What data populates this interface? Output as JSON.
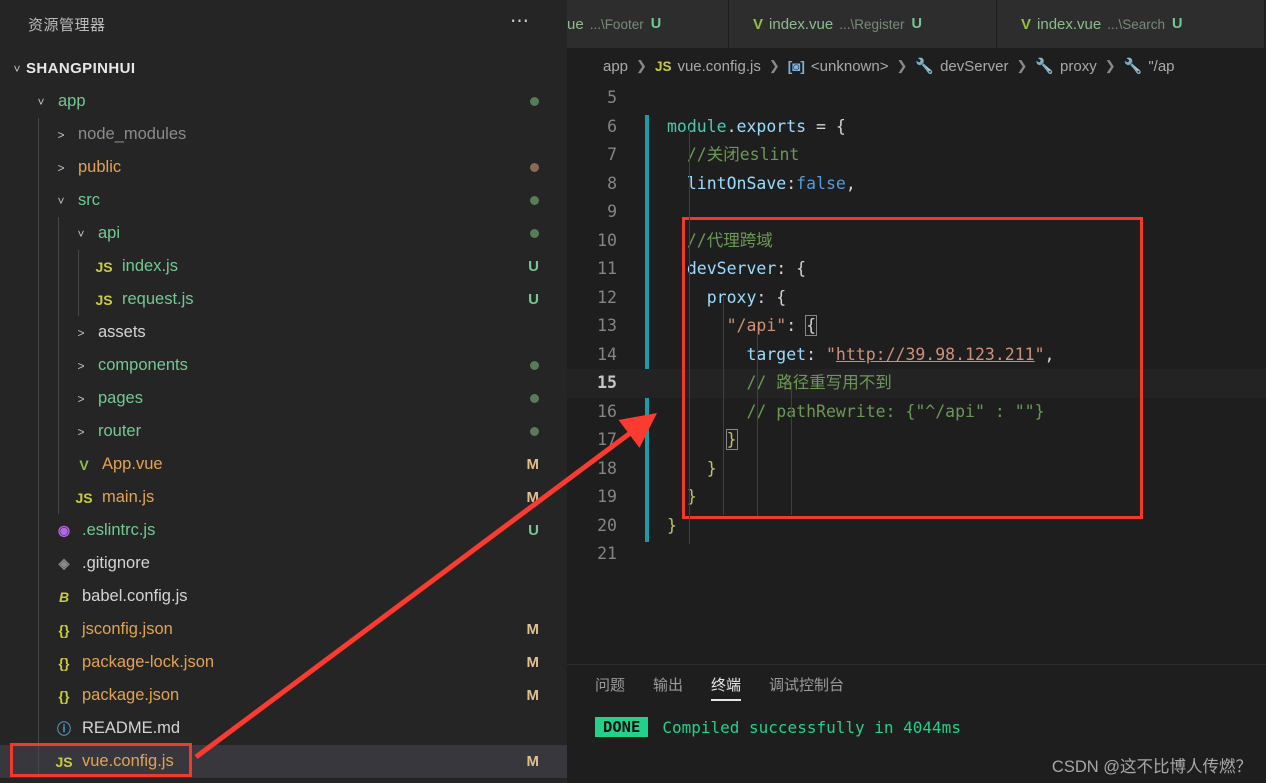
{
  "sidebar": {
    "title": "资源管理器",
    "actions_icon": "more-actions-icon",
    "root": "SHANGPINHUI",
    "items": [
      {
        "label": "app",
        "type": "folder",
        "expanded": true,
        "depth": 1,
        "icon": "chevron-down-icon",
        "color": "c-folder-green",
        "badge": "",
        "dot": "dot-green"
      },
      {
        "label": "node_modules",
        "type": "folder",
        "expanded": false,
        "depth": 2,
        "icon": "chevron-right-icon",
        "color": "c-folder-gray",
        "badge": "",
        "dot": ""
      },
      {
        "label": "public",
        "type": "folder",
        "expanded": false,
        "depth": 2,
        "icon": "chevron-right-icon",
        "color": "c-folder-orange",
        "badge": "",
        "dot": "dot-brown"
      },
      {
        "label": "src",
        "type": "folder",
        "expanded": true,
        "depth": 2,
        "icon": "chevron-down-icon",
        "color": "c-folder-green",
        "badge": "",
        "dot": "dot-green"
      },
      {
        "label": "api",
        "type": "folder",
        "expanded": true,
        "depth": 3,
        "icon": "chevron-down-icon",
        "color": "c-folder-green",
        "badge": "",
        "dot": "dot-green"
      },
      {
        "label": "index.js",
        "type": "file",
        "depth": 4,
        "fileicon": "js-icon",
        "iconclass": "ic-js",
        "icontext": "JS",
        "color": "c-file-green",
        "badge": "U",
        "badgeclass": "badge-U"
      },
      {
        "label": "request.js",
        "type": "file",
        "depth": 4,
        "fileicon": "js-icon",
        "iconclass": "ic-js",
        "icontext": "JS",
        "color": "c-file-green",
        "badge": "U",
        "badgeclass": "badge-U"
      },
      {
        "label": "assets",
        "type": "folder",
        "expanded": false,
        "depth": 3,
        "icon": "chevron-right-icon",
        "color": "c-file-dimwhite",
        "badge": "",
        "dot": ""
      },
      {
        "label": "components",
        "type": "folder",
        "expanded": false,
        "depth": 3,
        "icon": "chevron-right-icon",
        "color": "c-folder-green",
        "badge": "",
        "dot": "dot-green"
      },
      {
        "label": "pages",
        "type": "folder",
        "expanded": false,
        "depth": 3,
        "icon": "chevron-right-icon",
        "color": "c-folder-green",
        "badge": "",
        "dot": "dot-green"
      },
      {
        "label": "router",
        "type": "folder",
        "expanded": false,
        "depth": 3,
        "icon": "chevron-right-icon",
        "color": "c-folder-green",
        "badge": "",
        "dot": "dot-green"
      },
      {
        "label": "App.vue",
        "type": "file",
        "depth": 3,
        "fileicon": "vue-icon",
        "iconclass": "ic-vue",
        "icontext": "V",
        "color": "c-file-orange",
        "badge": "M",
        "badgeclass": "badge-M"
      },
      {
        "label": "main.js",
        "type": "file",
        "depth": 3,
        "fileicon": "js-icon",
        "iconclass": "ic-js",
        "icontext": "JS",
        "color": "c-file-orange",
        "badge": "M",
        "badgeclass": "badge-M"
      },
      {
        "label": ".eslintrc.js",
        "type": "file",
        "depth": 2,
        "fileicon": "eslint-icon",
        "iconclass": "ic-eslint",
        "icontext": "◉",
        "color": "c-file-green",
        "badge": "U",
        "badgeclass": "badge-U"
      },
      {
        "label": ".gitignore",
        "type": "file",
        "depth": 2,
        "fileicon": "git-icon",
        "iconclass": "ic-git",
        "icontext": "◈",
        "color": "c-file-dimwhite",
        "badge": "",
        "badgeclass": ""
      },
      {
        "label": "babel.config.js",
        "type": "file",
        "depth": 2,
        "fileicon": "babel-icon",
        "iconclass": "ic-babel",
        "icontext": "B",
        "color": "c-file-dimwhite",
        "badge": "",
        "badgeclass": ""
      },
      {
        "label": "jsconfig.json",
        "type": "file",
        "depth": 2,
        "fileicon": "json-icon",
        "iconclass": "ic-json",
        "icontext": "{}",
        "color": "c-file-orange",
        "badge": "M",
        "badgeclass": "badge-M"
      },
      {
        "label": "package-lock.json",
        "type": "file",
        "depth": 2,
        "fileicon": "json-icon",
        "iconclass": "ic-json",
        "icontext": "{}",
        "color": "c-file-orange",
        "badge": "M",
        "badgeclass": "badge-M"
      },
      {
        "label": "package.json",
        "type": "file",
        "depth": 2,
        "fileicon": "json-icon",
        "iconclass": "ic-json",
        "icontext": "{}",
        "color": "c-file-orange",
        "badge": "M",
        "badgeclass": "badge-M"
      },
      {
        "label": "README.md",
        "type": "file",
        "depth": 2,
        "fileicon": "markdown-icon",
        "iconclass": "ic-md",
        "icontext": "ⓘ",
        "color": "c-file-dimwhite",
        "badge": "",
        "badgeclass": ""
      },
      {
        "label": "vue.config.js",
        "type": "file",
        "depth": 2,
        "fileicon": "js-icon",
        "iconclass": "ic-js",
        "icontext": "JS",
        "color": "c-file-orange",
        "badge": "M",
        "badgeclass": "badge-M",
        "selected": true,
        "highlighted": true
      }
    ]
  },
  "tabs": [
    {
      "name": "ue",
      "desc": "...\\Footer",
      "badge": "U",
      "icon": "vue-icon",
      "clipped": true,
      "active": false
    },
    {
      "name": "index.vue",
      "desc": "...\\Register",
      "badge": "U",
      "icon": "vue-icon",
      "clipped": false,
      "active": false
    },
    {
      "name": "index.vue",
      "desc": "...\\Search",
      "badge": "U",
      "icon": "vue-icon",
      "clipped": false,
      "active": false
    }
  ],
  "breadcrumb": [
    {
      "label": "app",
      "icon": ""
    },
    {
      "label": "vue.config.js",
      "icon": "js-icon",
      "icontext": "JS",
      "iconclass": "bc-js"
    },
    {
      "label": "<unknown>",
      "icon": "module-icon",
      "icontext": "[◙]",
      "iconclass": "bc-mod"
    },
    {
      "label": "devServer",
      "icon": "property-icon",
      "icontext": "🔧",
      "iconclass": "bc-wrench"
    },
    {
      "label": "proxy",
      "icon": "property-icon",
      "icontext": "🔧",
      "iconclass": "bc-wrench"
    },
    {
      "label": "\"/ap",
      "icon": "property-icon",
      "icontext": "🔧",
      "iconclass": "bc-wrench"
    }
  ],
  "code": {
    "lines": [
      {
        "n": "5",
        "text": "",
        "cur": false
      },
      {
        "n": "6",
        "text": "module.exports = {",
        "cur": false
      },
      {
        "n": "7",
        "text": "  //关闭eslint",
        "cur": false
      },
      {
        "n": "8",
        "text": "  lintOnSave:false,",
        "cur": false
      },
      {
        "n": "9",
        "text": "",
        "cur": false
      },
      {
        "n": "10",
        "text": "  //代理跨域",
        "cur": false
      },
      {
        "n": "11",
        "text": "  devServer: {",
        "cur": false
      },
      {
        "n": "12",
        "text": "    proxy: {",
        "cur": false
      },
      {
        "n": "13",
        "text": "      \"/api\": {",
        "cur": false
      },
      {
        "n": "14",
        "text": "        target: \"http://39.98.123.211\",",
        "cur": false
      },
      {
        "n": "15",
        "text": "        // 路径重写用不到",
        "cur": true
      },
      {
        "n": "16",
        "text": "        // pathRewrite: {\"^/api\" : \"\"}",
        "cur": false
      },
      {
        "n": "17",
        "text": "      }",
        "cur": false
      },
      {
        "n": "18",
        "text": "    }",
        "cur": false
      },
      {
        "n": "19",
        "text": "  }",
        "cur": false
      },
      {
        "n": "20",
        "text": "}",
        "cur": false
      },
      {
        "n": "21",
        "text": "",
        "cur": false
      }
    ],
    "target_url": "http://39.98.123.211"
  },
  "panel": {
    "tabs": [
      {
        "label": "问题",
        "active": false
      },
      {
        "label": "输出",
        "active": false
      },
      {
        "label": "终端",
        "active": true
      },
      {
        "label": "调试控制台",
        "active": false
      }
    ],
    "terminal": {
      "tag": "DONE",
      "message": "Compiled successfully in 4044ms"
    }
  },
  "watermark": "CSDN @这不比博人传燃？",
  "colors": {
    "annotation_red": "#f4382c",
    "sidebar_bg": "#252526",
    "editor_bg": "#1e1e1e",
    "tab_bg": "#2d2d2d",
    "changebar_teal": "#1b9aaa",
    "done_green": "#23d18b"
  }
}
